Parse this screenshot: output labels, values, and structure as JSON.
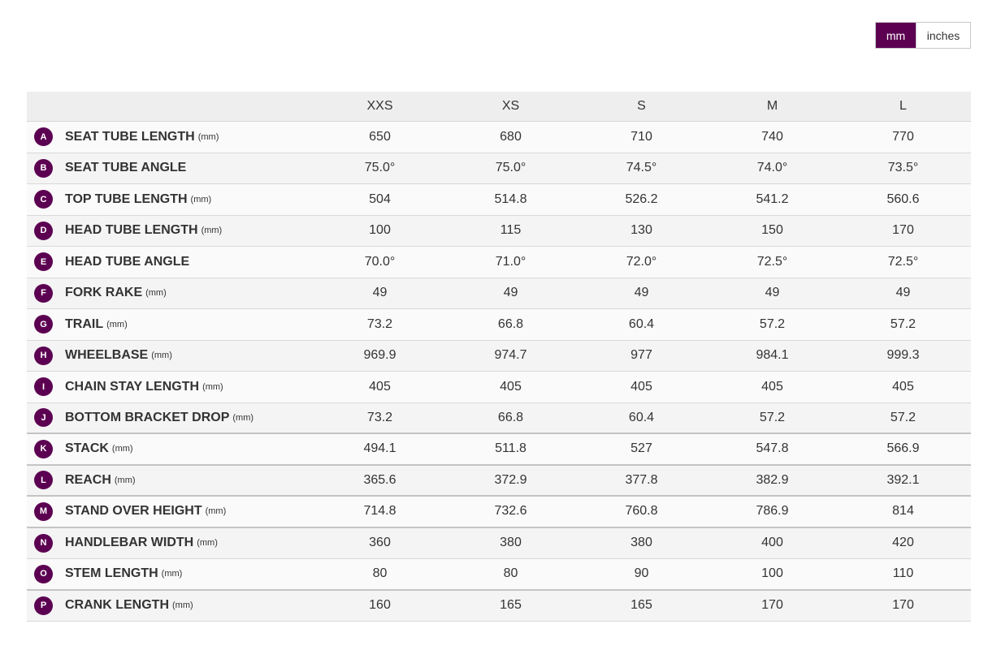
{
  "units_toggle": {
    "mm_label": "mm",
    "inches_label": "inches"
  },
  "sizes": [
    "XXS",
    "XS",
    "S",
    "M",
    "L"
  ],
  "rows": [
    {
      "letter": "A",
      "name": "SEAT TUBE LENGTH",
      "unit": "(mm)",
      "values": [
        "650",
        "680",
        "710",
        "740",
        "770"
      ]
    },
    {
      "letter": "B",
      "name": "SEAT TUBE ANGLE",
      "unit": "",
      "values": [
        "75.0°",
        "75.0°",
        "74.5°",
        "74.0°",
        "73.5°"
      ]
    },
    {
      "letter": "C",
      "name": "TOP TUBE LENGTH",
      "unit": "(mm)",
      "values": [
        "504",
        "514.8",
        "526.2",
        "541.2",
        "560.6"
      ]
    },
    {
      "letter": "D",
      "name": "HEAD TUBE LENGTH",
      "unit": "(mm)",
      "values": [
        "100",
        "115",
        "130",
        "150",
        "170"
      ]
    },
    {
      "letter": "E",
      "name": "HEAD TUBE ANGLE",
      "unit": "",
      "values": [
        "70.0°",
        "71.0°",
        "72.0°",
        "72.5°",
        "72.5°"
      ]
    },
    {
      "letter": "F",
      "name": "FORK RAKE",
      "unit": "(mm)",
      "values": [
        "49",
        "49",
        "49",
        "49",
        "49"
      ]
    },
    {
      "letter": "G",
      "name": "TRAIL",
      "unit": "(mm)",
      "values": [
        "73.2",
        "66.8",
        "60.4",
        "57.2",
        "57.2"
      ]
    },
    {
      "letter": "H",
      "name": "WHEELBASE",
      "unit": "(mm)",
      "values": [
        "969.9",
        "974.7",
        "977",
        "984.1",
        "999.3"
      ]
    },
    {
      "letter": "I",
      "name": "CHAIN STAY LENGTH",
      "unit": "(mm)",
      "values": [
        "405",
        "405",
        "405",
        "405",
        "405"
      ]
    },
    {
      "letter": "J",
      "name": "BOTTOM BRACKET DROP",
      "unit": "(mm)",
      "values": [
        "73.2",
        "66.8",
        "60.4",
        "57.2",
        "57.2"
      ]
    },
    {
      "letter": "K",
      "name": "STACK",
      "unit": "(mm)",
      "values": [
        "494.1",
        "511.8",
        "527",
        "547.8",
        "566.9"
      ]
    },
    {
      "letter": "L",
      "name": "REACH",
      "unit": "(mm)",
      "values": [
        "365.6",
        "372.9",
        "377.8",
        "382.9",
        "392.1"
      ]
    },
    {
      "letter": "M",
      "name": "STAND OVER HEIGHT",
      "unit": "(mm)",
      "values": [
        "714.8",
        "732.6",
        "760.8",
        "786.9",
        "814"
      ]
    },
    {
      "letter": "N",
      "name": "HANDLEBAR WIDTH",
      "unit": "(mm)",
      "values": [
        "360",
        "380",
        "380",
        "400",
        "420"
      ]
    },
    {
      "letter": "O",
      "name": "STEM LENGTH",
      "unit": "(mm)",
      "values": [
        "80",
        "80",
        "90",
        "100",
        "110"
      ]
    },
    {
      "letter": "P",
      "name": "CRANK LENGTH",
      "unit": "(mm)",
      "values": [
        "160",
        "165",
        "165",
        "170",
        "170"
      ]
    }
  ],
  "colors": {
    "accent": "#5c0052",
    "header_bg": "#eeeeee"
  }
}
